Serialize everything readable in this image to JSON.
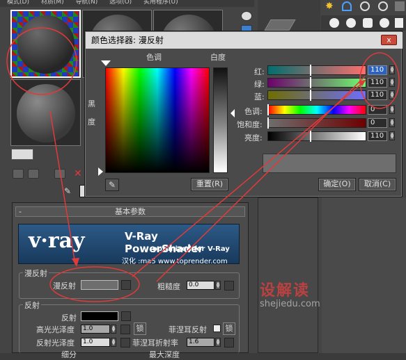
{
  "menubar": {
    "text": "模式(D) 材质(M) 导航(N) 选项(O) 实用程序(U)"
  },
  "color_dialog": {
    "title": "颜色选择器: 漫反射",
    "hue_label": "色调",
    "whiteness_label": "白度",
    "blackness_label": "黑\n度",
    "red_label": "红:",
    "green_label": "绿:",
    "blue_label": "蓝:",
    "red_value": "110",
    "green_value": "110",
    "blue_value": "110",
    "hue_label2": "色调:",
    "sat_label": "饱和度:",
    "val_label": "亮度:",
    "hue_value": "0",
    "sat_value": "0",
    "val_value": "110",
    "reset_button": "重置(R)",
    "ok_button": "确定(O)",
    "cancel_button": "取消(C)",
    "close_glyph": "x",
    "preview_color": "#6e6e6e"
  },
  "rollout": {
    "title": "基本参数",
    "collapse": "-",
    "vray_logo": "v·ray",
    "vray_title": "V-Ray PowerShader",
    "vray_subtitle": "optimized for V-Ray",
    "vray_credit": "汉化 :ma5 www.toprender.com",
    "diffuse_group": "漫反射",
    "diffuse_label": "漫反射",
    "diffuse_color": "#6e6e6e",
    "roughness_label": "粗糙度",
    "roughness_value": "0.0",
    "reflect_group": "反射",
    "reflect_label": "反射",
    "hilight_gloss_label": "高光光泽度",
    "hilight_gloss_value": "1.0",
    "lock_label": "锁",
    "fresnel_label": "菲涅耳反射",
    "refl_gloss_label": "反射光泽度",
    "refl_gloss_value": "1.0",
    "fresnel_ior_label": "菲涅耳折射率",
    "fresnel_ior_value": "1.6",
    "subdivs_label": "细分",
    "max_depth_label": "最大深度"
  },
  "watermark": {
    "brand": "设解读",
    "url": "shejiedu.com"
  },
  "annotation_color": "#e03a3a"
}
